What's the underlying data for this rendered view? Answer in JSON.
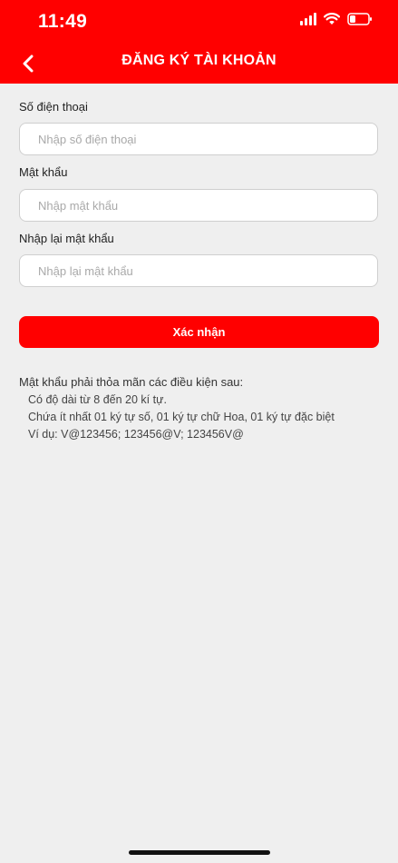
{
  "status_bar": {
    "time": "11:49"
  },
  "header": {
    "title": "ĐĂNG KÝ TÀI KHOẢN",
    "back_icon": "chevron-left-icon"
  },
  "form": {
    "phone": {
      "label": "Số điện thoại",
      "placeholder": "Nhập số điện thoại",
      "value": ""
    },
    "password": {
      "label": "Mật khẩu",
      "placeholder": "Nhập mật khẩu",
      "value": ""
    },
    "confirm_password": {
      "label": "Nhập lại mật khẩu",
      "placeholder": "Nhập lại mật khẩu",
      "value": ""
    },
    "submit_label": "Xác nhận"
  },
  "rules": {
    "title": "Mật khẩu phải thỏa mãn các điều kiện sau:",
    "items": [
      "Có độ dài từ 8 đến 20 kí tự.",
      "Chứa ít nhất 01 ký tự số, 01 ký tự chữ Hoa, 01 ký tự đặc biệt",
      "Ví dụ: V@123456; 123456@V; 123456V@"
    ]
  },
  "colors": {
    "accent": "#ff0000",
    "background": "#efefef"
  }
}
